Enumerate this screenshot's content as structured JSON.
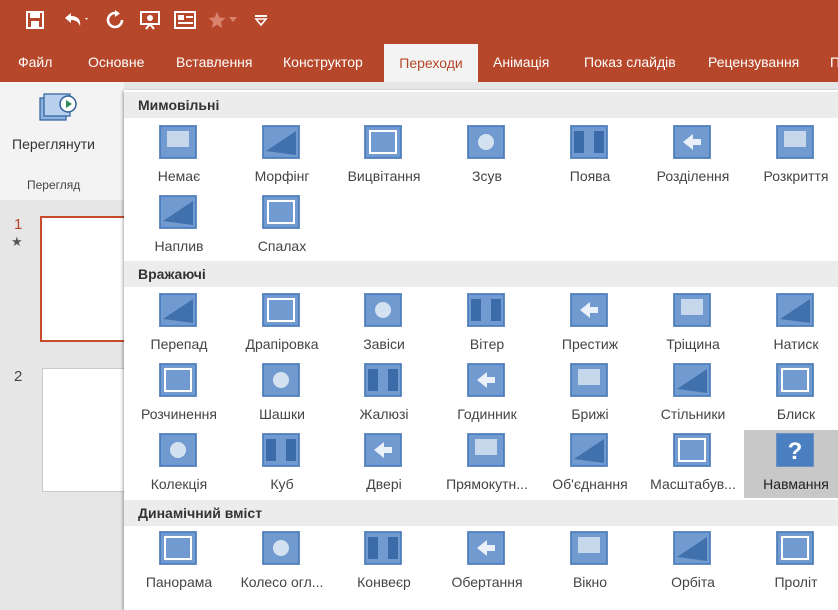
{
  "colors": {
    "accent": "#b7472a",
    "thumb_blue": "#4a7fc1",
    "thumb_light": "#b9d1ee",
    "thumb_dark": "#2e5f9e",
    "selected_bg": "#c8c8c8"
  },
  "quick_access": [
    {
      "icon": "save-icon"
    },
    {
      "icon": "undo-icon"
    },
    {
      "icon": "redo-icon"
    },
    {
      "icon": "from-beginning-icon"
    },
    {
      "icon": "form-icon"
    },
    {
      "icon": "star-icon"
    },
    {
      "icon": "customize-dropdown-icon"
    }
  ],
  "tabs": [
    {
      "label": "Файл"
    },
    {
      "label": "Основне"
    },
    {
      "label": "Вставлення"
    },
    {
      "label": "Конструктор"
    },
    {
      "label": "Переходи"
    },
    {
      "label": "Анімація"
    },
    {
      "label": "Показ слайдів"
    },
    {
      "label": "Рецензування"
    },
    {
      "label": "П"
    }
  ],
  "ribbon": {
    "preview_label": "Переглянути",
    "group_label": "Перегляд"
  },
  "slides": [
    {
      "number": "1",
      "marker": "★"
    },
    {
      "number": "2",
      "marker": ""
    }
  ],
  "sections": [
    {
      "title": "Мимовільні",
      "items": [
        {
          "label": "Немає",
          "icon": "none-transition-icon"
        },
        {
          "label": "Морфінг",
          "icon": "morph-transition-icon"
        },
        {
          "label": "Вицвітання",
          "icon": "fade-transition-icon"
        },
        {
          "label": "Зсув",
          "icon": "push-transition-icon"
        },
        {
          "label": "Поява",
          "icon": "wipe-transition-icon"
        },
        {
          "label": "Розділення",
          "icon": "split-transition-icon"
        },
        {
          "label": "Розкриття",
          "icon": "reveal-transition-icon"
        },
        {
          "label": "Наплив",
          "icon": "cover-transition-icon"
        },
        {
          "label": "Спалах",
          "icon": "flash-transition-icon"
        }
      ]
    },
    {
      "title": "Вражаючі",
      "items": [
        {
          "label": "Перепад",
          "icon": "fall-over-transition-icon"
        },
        {
          "label": "Драпіровка",
          "icon": "drape-transition-icon"
        },
        {
          "label": "Завіси",
          "icon": "curtains-transition-icon"
        },
        {
          "label": "Вітер",
          "icon": "wind-transition-icon"
        },
        {
          "label": "Престиж",
          "icon": "prestige-transition-icon"
        },
        {
          "label": "Тріщина",
          "icon": "fracture-transition-icon"
        },
        {
          "label": "Натиск",
          "icon": "crush-transition-icon"
        },
        {
          "label": "Розчинення",
          "icon": "dissolve-transition-icon"
        },
        {
          "label": "Шашки",
          "icon": "checkerboard-transition-icon"
        },
        {
          "label": "Жалюзі",
          "icon": "blinds-transition-icon"
        },
        {
          "label": "Годинник",
          "icon": "clock-transition-icon"
        },
        {
          "label": "Брижі",
          "icon": "ripple-transition-icon"
        },
        {
          "label": "Стільники",
          "icon": "honeycomb-transition-icon"
        },
        {
          "label": "Блиск",
          "icon": "glitter-transition-icon"
        },
        {
          "label": "Колекція",
          "icon": "gallery-transition-icon"
        },
        {
          "label": "Куб",
          "icon": "cube-transition-icon"
        },
        {
          "label": "Двері",
          "icon": "doors-transition-icon"
        },
        {
          "label": "Прямокутн...",
          "icon": "box-transition-icon"
        },
        {
          "label": "Об'єднання",
          "icon": "comb-transition-icon"
        },
        {
          "label": "Масштабув...",
          "icon": "zoom-transition-icon"
        },
        {
          "label": "Навмання",
          "icon": "random-transition-icon"
        }
      ]
    },
    {
      "title": "Динамічний вміст",
      "items": [
        {
          "label": "Панорама",
          "icon": "pan-transition-icon"
        },
        {
          "label": "Колесо огл...",
          "icon": "ferris-wheel-transition-icon"
        },
        {
          "label": "Конвеєр",
          "icon": "conveyor-transition-icon"
        },
        {
          "label": "Обертання",
          "icon": "rotate-transition-icon"
        },
        {
          "label": "Вікно",
          "icon": "window-transition-icon"
        },
        {
          "label": "Орбіта",
          "icon": "orbit-transition-icon"
        },
        {
          "label": "Проліт",
          "icon": "fly-through-transition-icon"
        }
      ]
    }
  ]
}
